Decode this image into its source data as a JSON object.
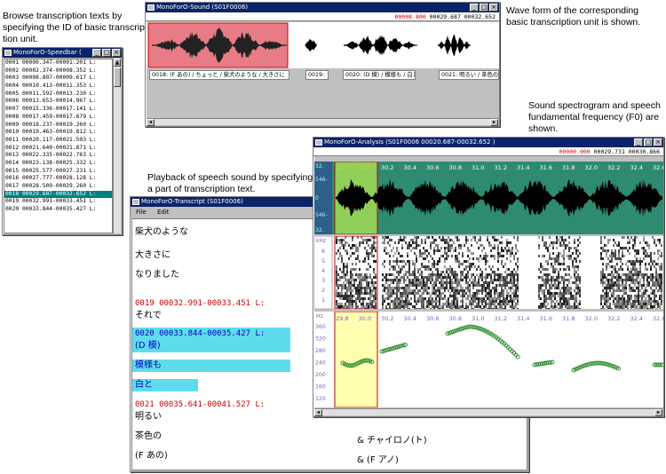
{
  "captions": {
    "browse": [
      "Browse transcription texts by",
      "specifying the ID of basic transcrip-",
      "tion unit."
    ],
    "waveform": [
      "Wave form of the corresponding",
      "basic transcription unit is shown."
    ],
    "spectrogram": [
      "Sound spectrogram and speech",
      "fundamental frequency (F0) are",
      "shown."
    ],
    "playback": [
      "Playback of speech sound by specifying",
      "a part of transcription text."
    ]
  },
  "speedbar": {
    "title": "MonoForO-Speedbar (",
    "rows": [
      "0001 00000.347-00001.201 L:",
      "0002 00002.374-00008.352 L:",
      "0003 00008.807-00009.617 L:",
      "0004 00010.413-00011.353 L:",
      "0005 00011.592-00013.230 L:",
      "0006 00013.653-00014.967 L:",
      "0007 00015.336-00017.141 L:",
      "0008 00017.459-00017.679 L:",
      "0009 00018.237-00019.260 L:",
      "0010 00019.463-00019.812 L:",
      "0011 00020.117-00021.503 L:",
      "0012 00021.640-00021.871 L:",
      "0013 00022.335-00022.763 L:",
      "0014 00023.138-00025.332 L:",
      "0015 00025.577-00027.231 L:",
      "0016 00027.777-00028.128 L:",
      "0017 00028.509-00029.260 L:",
      "0018 00029.687-00032.652 L:",
      "0019 00032.991-00033.451 L:",
      "0020 00033.844-00035.427 L:"
    ],
    "selected_index": 17
  },
  "sound": {
    "title": "MonoForO-Sound (S01F0006)",
    "time_start": "00008.800",
    "time_range": "00029.687 00032.652",
    "segments": [
      "0018: (F あの) / ちょっと / 柴犬のような / 大きさに",
      "0019: ",
      "0020: (D 模) / 模様も / 白と",
      "0021: 明るい / 茶色の"
    ]
  },
  "analysis": {
    "title": "MonoForO-Analysis (S01F0006 00020.687-00032.652 )",
    "time_start": "00000.000",
    "time_range": "00029.731 00030.866",
    "wave_axis": [
      "32.",
      "546-",
      "0",
      "546-",
      "32."
    ],
    "ticks": [
      "29.8",
      "30.0",
      "30.2",
      "30.4",
      "30.6",
      "30.8",
      "31.0",
      "31.2",
      "31.4",
      "31.6",
      "31.8",
      "32.0",
      "32.2",
      "32.4",
      "32.6"
    ],
    "khz_label": "kHz",
    "khz_ticks": [
      "6",
      "5",
      "4",
      "3",
      "2",
      "1"
    ],
    "hz_label": "Hz",
    "hz_ticks": [
      "360",
      "320",
      "280",
      "240",
      "200",
      "160",
      "120"
    ]
  },
  "transcript": {
    "title": "MonoForO-Transcript (S01F0006)",
    "menu": [
      "File",
      "Edit"
    ],
    "lines": [
      {
        "text": "柴犬のような",
        "kind": "text"
      },
      {
        "text": "大きさに",
        "kind": "text"
      },
      {
        "text": "なりました",
        "kind": "text"
      },
      {
        "text": "0019 00032.991-00033.451 L:",
        "kind": "hdr"
      },
      {
        "text": "それで",
        "kind": "text"
      },
      {
        "text": "0020 00033.844-00035.427 L:",
        "kind": "hdr-hl"
      },
      {
        "text": "(D 模)",
        "kind": "blue-hl"
      },
      {
        "text": "模様も",
        "kind": "blue-hl"
      },
      {
        "text": "白と",
        "kind": "blue-hl"
      },
      {
        "text": "0021 00035.641-00041.527 L:",
        "kind": "hdr"
      },
      {
        "text": "明るい",
        "kind": "text"
      },
      {
        "text": "茶色の",
        "kind": "text"
      },
      {
        "text": "(F あの)",
        "kind": "text"
      }
    ],
    "kana": [
      "& チャイロノ(ト)",
      "& (F アノ)"
    ]
  }
}
